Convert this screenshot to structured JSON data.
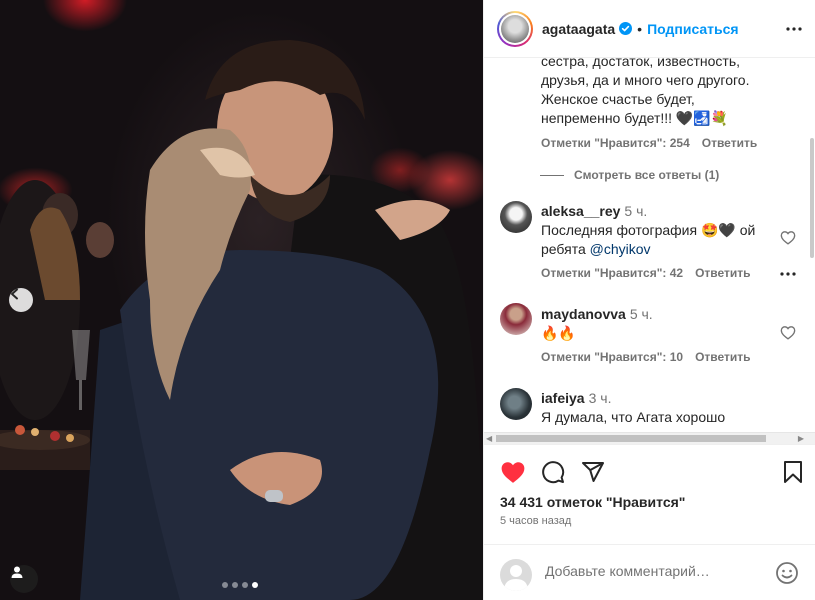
{
  "post": {
    "username": "agataagata",
    "follow_label": "Подписаться",
    "separator": "•",
    "likes_text": "34 431 отметок \"Нравится\"",
    "time_ago": "5 часов назад",
    "carousel": {
      "total": 4,
      "active": 4
    }
  },
  "comments": {
    "partial": {
      "lines": [
        "сестра, достаток, известность,",
        "друзья, да и много чего другого.",
        "Женское счастье будет,",
        "непременно будет!!! 🖤🛃💐"
      ],
      "likes_label": "Отметки \"Нравится\": 254",
      "reply_label": "Ответить"
    },
    "view_replies_label": "Смотреть все ответы (1)",
    "items": [
      {
        "user": "aleksa__rey",
        "time": "5 ч.",
        "text_line1": "Последняя фотография 🤩🖤 ой",
        "text_line2_prefix": "ребята ",
        "mention": "@chyikov",
        "likes_label": "Отметки \"Нравится\": 42",
        "reply_label": "Ответить"
      },
      {
        "user": "maydanovva",
        "time": "5 ч.",
        "text": "🔥🔥",
        "likes_label": "Отметки \"Нравится\": 10",
        "reply_label": "Ответить"
      },
      {
        "user": "iafeiya",
        "time": "3 ч.",
        "text": "Я думала, что Агата хорошо"
      }
    ]
  },
  "add_comment": {
    "placeholder": "Добавьте комментарий…"
  },
  "colors": {
    "accent": "#0095f6",
    "like_red": "#ff3040",
    "muted": "#737373"
  }
}
